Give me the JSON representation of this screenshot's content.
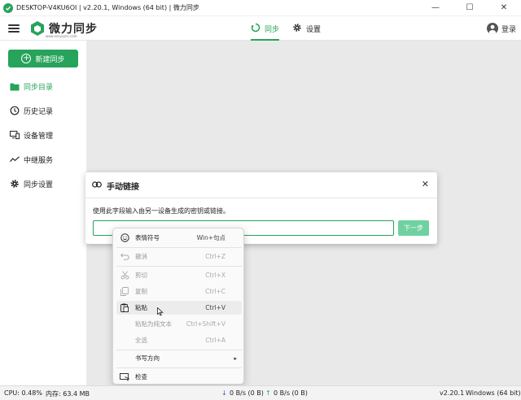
{
  "window": {
    "title": "DESKTOP-V4KU6OI | v2.20.1, Windows (64 bit) | 微力同步",
    "minimize": "—",
    "maximize": "☐",
    "close": "✕"
  },
  "header": {
    "logo_text": "微力同步",
    "logo_sub": "www.verysync.com",
    "tabs": [
      {
        "label": "同步",
        "icon": "sync-icon",
        "active": true
      },
      {
        "label": "设置",
        "icon": "gear-icon",
        "active": false
      }
    ],
    "login_label": "登录"
  },
  "sidebar": {
    "new_sync_label": "新建同步",
    "items": [
      {
        "label": "同步目录",
        "icon": "folder-icon",
        "active": true
      },
      {
        "label": "历史记录",
        "icon": "history-icon",
        "active": false
      },
      {
        "label": "设备管理",
        "icon": "devices-icon",
        "active": false
      },
      {
        "label": "中继服务",
        "icon": "relay-icon",
        "active": false
      },
      {
        "label": "同步设置",
        "icon": "gear-icon",
        "active": false
      }
    ]
  },
  "dialog": {
    "title": "手动链接",
    "close": "✕",
    "description": "使用此字段输入由另一设备生成的密钥或链接。",
    "input_value": "",
    "next_label": "下一步"
  },
  "context_menu": {
    "items": [
      {
        "label": "表情符号",
        "shortcut": "Win+句点",
        "icon": "emoji-icon",
        "disabled": false
      },
      {
        "label": "撤消",
        "shortcut": "Ctrl+Z",
        "icon": "undo-icon",
        "disabled": true
      },
      {
        "label": "剪切",
        "shortcut": "Ctrl+X",
        "icon": "cut-icon",
        "disabled": true
      },
      {
        "label": "复制",
        "shortcut": "Ctrl+C",
        "icon": "copy-icon",
        "disabled": true
      },
      {
        "label": "粘贴",
        "shortcut": "Ctrl+V",
        "icon": "paste-icon",
        "disabled": false
      },
      {
        "label": "粘贴为纯文本",
        "shortcut": "Ctrl+Shift+V",
        "icon": "",
        "disabled": true
      },
      {
        "label": "全选",
        "shortcut": "Ctrl+A",
        "icon": "",
        "disabled": true
      },
      {
        "label": "书写方向",
        "shortcut": "",
        "icon": "",
        "disabled": false,
        "submenu": "▸"
      },
      {
        "label": "检查",
        "shortcut": "",
        "icon": "inspect-icon",
        "disabled": false
      }
    ]
  },
  "statusbar": {
    "cpu": "CPU: 0.48%",
    "memory": "内存: 63.4 MB",
    "down_arrow": "↓",
    "download": "0 B/s (0 B)",
    "up_arrow": "↑",
    "upload": "0 B/s (0 B)",
    "version": "v2.20.1",
    "os": "Windows (64 bit)"
  },
  "colors": {
    "accent": "#27a35b",
    "next_button": "#6fd1a0",
    "overlay": "#e9e9e9"
  }
}
